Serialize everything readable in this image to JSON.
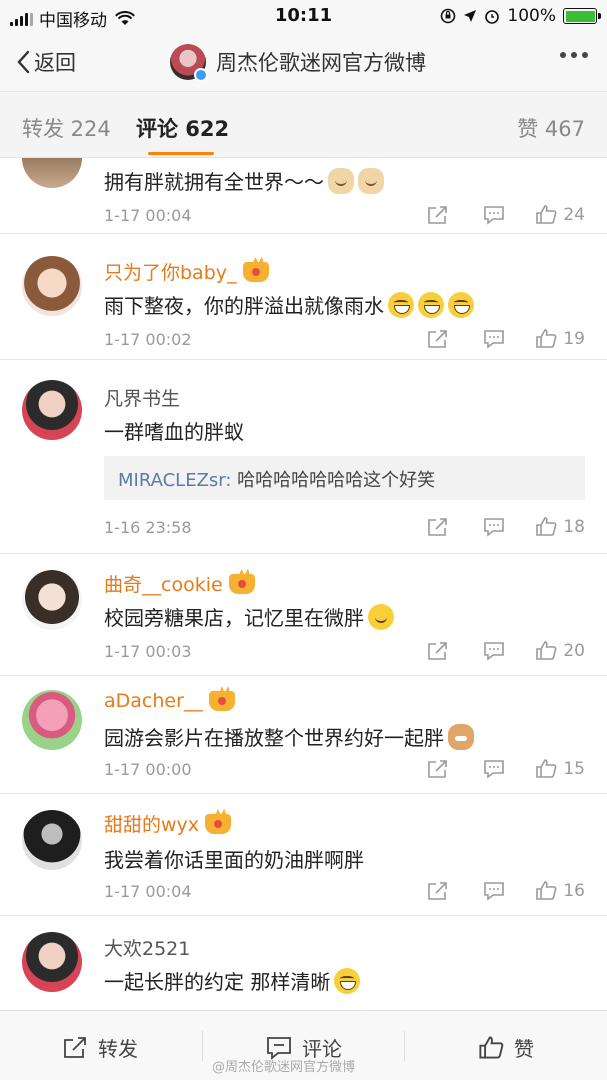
{
  "status_bar": {
    "carrier": "中国移动",
    "time": "10:11",
    "battery": "100%"
  },
  "nav": {
    "back_label": "返回",
    "title": "周杰伦歌迷网官方微博"
  },
  "tabs": {
    "repost": "转发 224",
    "comment": "评论 622",
    "like": "赞 467"
  },
  "comments": [
    {
      "name": "",
      "text": "拥有胖就拥有全世界～～",
      "time": "1-17 00:04",
      "likes": "24",
      "emoji": [
        "dog-icon",
        "dog-icon"
      ]
    },
    {
      "name": "只为了你baby_",
      "text": "雨下整夜，你的胖溢出就像雨水",
      "time": "1-17 00:02",
      "likes": "19",
      "emoji": [
        "laugh-cry-icon",
        "laugh-cry-icon",
        "laugh-cry-icon"
      ]
    },
    {
      "name": "凡界书生",
      "text": "一群嗜血的胖蚁",
      "time": "1-16 23:58",
      "likes": "18",
      "quote_name": "MIRACLEZsr:",
      "quote_text": " 哈哈哈哈哈哈哈这个好笑"
    },
    {
      "name": "曲奇__cookie",
      "text": "校园旁糖果店，记忆里在微胖",
      "time": "1-17 00:03",
      "likes": "20",
      "emoji": [
        "smile-icon"
      ]
    },
    {
      "name": "aDacher__",
      "text": "园游会影片在播放整个世界约好一起胖",
      "time": "1-17 00:00",
      "likes": "15",
      "emoji": [
        "cat-icon"
      ]
    },
    {
      "name": "甜甜的wyx",
      "text": "我尝着你话里面的奶油胖啊胖",
      "time": "1-17 00:04",
      "likes": "16"
    },
    {
      "name": "大欢2521",
      "text": "一起长胖的约定 那样清晰",
      "time": "",
      "likes": "",
      "emoji": [
        "laugh-cry-icon"
      ]
    }
  ],
  "bottom": {
    "repost": "转发",
    "comment": "评论",
    "like": "赞"
  },
  "watermark": "@周杰伦歌迷网官方微博",
  "colors": {
    "accent": "#ff8200",
    "vip_name": "#e87a19",
    "quote_name": "#5b7ba8"
  }
}
